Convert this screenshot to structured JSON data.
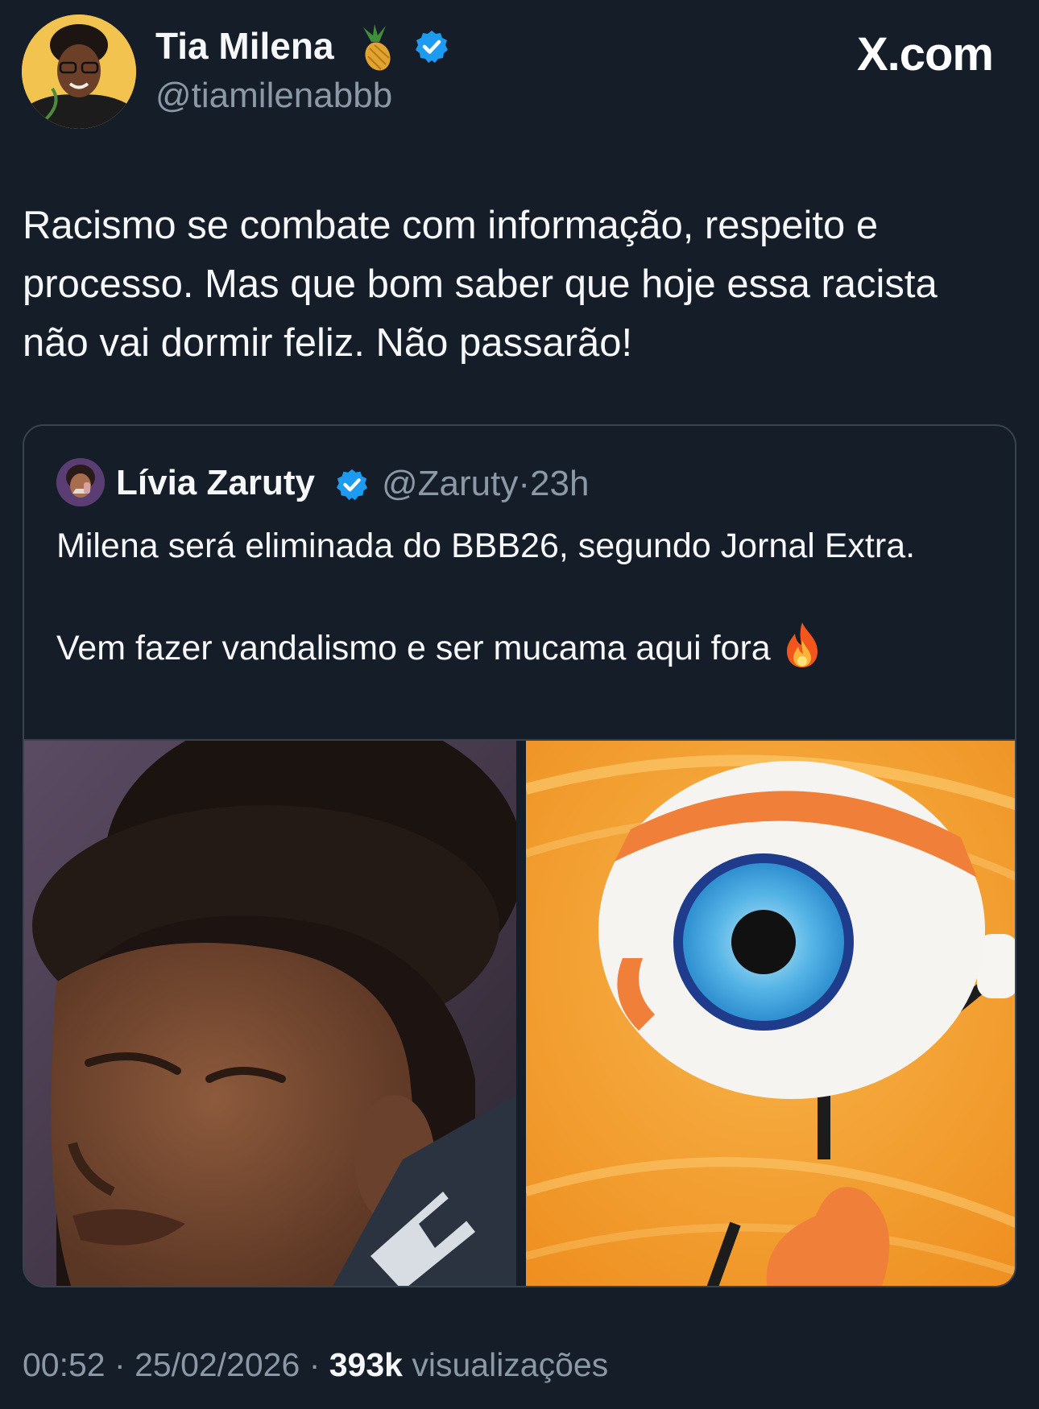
{
  "site": {
    "logo_text": "X.com"
  },
  "author": {
    "name": "Tia Milena",
    "handle": "@tiamilenabbb",
    "name_emoji": "pineapple-emoji",
    "verified_color": "#1d9bf0"
  },
  "tweet": {
    "text": "Racismo se combate com informação, respeito e processo. Mas que bom saber que hoje essa racista não vai dormir feliz. Não passarão!"
  },
  "quoted": {
    "name": "Lívia Zaruty",
    "handle": "@Zaruty",
    "separator": "·",
    "age": "23h",
    "line1": "Milena será eliminada do BBB26, segundo Jornal Extra.",
    "line2": "Vem fazer vandalismo e ser mucama aqui fora",
    "line2_emoji": "fire-emoji",
    "media": [
      "crying-woman-photo",
      "big-brother-eye-mascot-image"
    ]
  },
  "footer": {
    "time": "00:52",
    "separator": "·",
    "date": "25/02/2026",
    "views_count": "393k",
    "views_label": "visualizações"
  }
}
